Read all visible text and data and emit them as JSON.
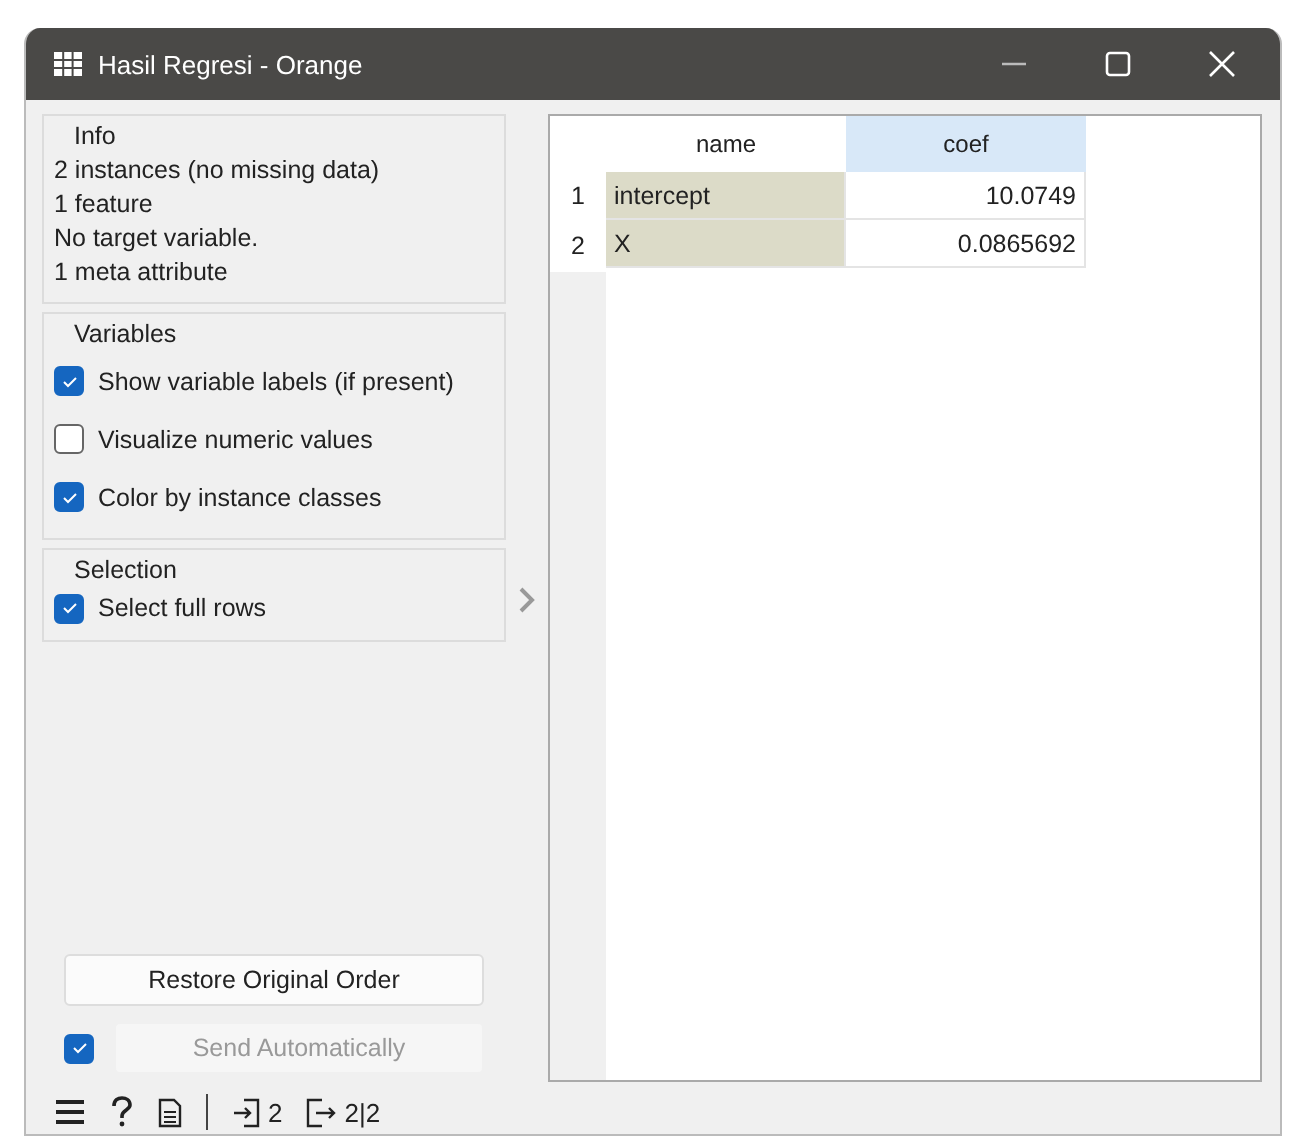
{
  "window": {
    "title": "Hasil Regresi - Orange"
  },
  "info": {
    "title": "Info",
    "lines": [
      "2 instances (no missing data)",
      "1  feature",
      "No target variable.",
      "1 meta attribute"
    ]
  },
  "variables": {
    "title": "Variables",
    "options": [
      {
        "label": "Show variable labels (if present)",
        "checked": true
      },
      {
        "label": "Visualize numeric values",
        "checked": false
      },
      {
        "label": "Color by instance classes",
        "checked": true
      }
    ]
  },
  "selection": {
    "title": "Selection",
    "options": [
      {
        "label": "Select full rows",
        "checked": true
      }
    ]
  },
  "restore_button": "Restore Original Order",
  "send": {
    "label": "Send Automatically",
    "checked": true,
    "disabled": true
  },
  "table": {
    "columns": [
      {
        "label": "name",
        "kind": "meta",
        "selected": false
      },
      {
        "label": "coef",
        "kind": "numeric",
        "selected": true
      }
    ],
    "rows": [
      {
        "index": "1",
        "cells": [
          "intercept",
          "10.0749"
        ]
      },
      {
        "index": "2",
        "cells": [
          "X",
          "0.0865692"
        ]
      }
    ]
  },
  "status_bar": {
    "input_count": "2",
    "output_count": "2|2"
  }
}
